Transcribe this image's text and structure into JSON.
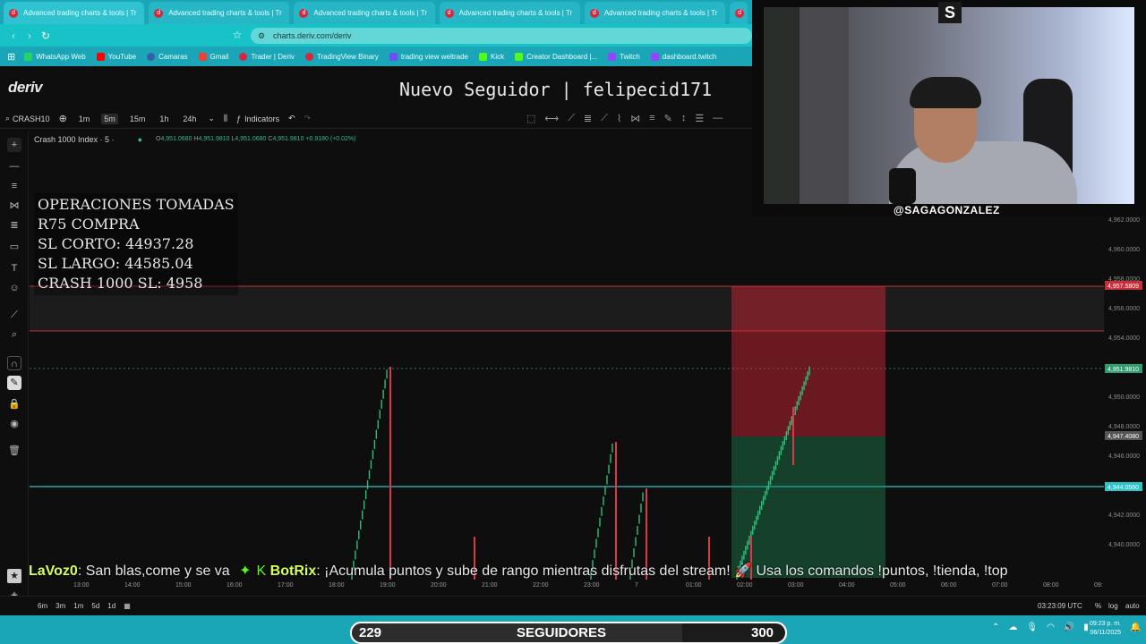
{
  "browser": {
    "tabs": [
      "Advanced trading charts & tools | Tr",
      "Advanced trading charts & tools | Tr",
      "Advanced trading charts & tools | Tr",
      "Advanced trading charts & tools | Tr",
      "Advanced trading charts & tools | Tr"
    ],
    "url": "charts.deriv.com/deriv",
    "bookmarks": [
      "WhatsApp Web",
      "YouTube",
      "Camaras",
      "Gmail",
      "Trader | Deriv",
      "TradingView Binary",
      "trading view weltrade",
      "Kick",
      "Creator Dashboard |...",
      "Twitch",
      "dashboard.twitch"
    ],
    "bookmark_colors": [
      "#25d366",
      "#ff0000",
      "#3a5da8",
      "#ea4335",
      "#d7263d",
      "#d7263d",
      "#6e4ff5",
      "#53fc18",
      "#53fc18",
      "#9146ff",
      "#9146ff"
    ]
  },
  "app": {
    "logo": "deriv",
    "alert": "Nuevo Seguidor | felipecid171"
  },
  "toolbar": {
    "symbol": "CRASH10",
    "timeframes": [
      "1m",
      "5m",
      "15m",
      "1h",
      "24h"
    ],
    "active_timeframe": "5m",
    "indicators": "Indicators"
  },
  "chart": {
    "legend": "Crash 1000 Index · 5 ·",
    "ohlc": {
      "o": "4,951.0680",
      "h": "4,951.9810",
      "l": "4,951.0680",
      "c": "4,951.9810",
      "change": "+0.9180 (+0.02%)"
    }
  },
  "overlay": {
    "title": "OPERACIONES TOMADAS",
    "lines": [
      "R75 COMPRA",
      "SL CORTO: 44937.28",
      "SL LARGO: 44585.04",
      "CRASH 1000 SL: 4958"
    ]
  },
  "webcam": {
    "handle": "@SAGAGONZALEZ"
  },
  "price_axis": {
    "labels": [
      "4,962.0000",
      "4,960.0000",
      "4,958.0000",
      "4,956.0000",
      "4,954.0000",
      "4,952.0000",
      "4,950.0000",
      "4,948.0000",
      "4,946.0000",
      "4,944.0000",
      "4,942.0000",
      "4,940.0000"
    ],
    "tags": {
      "red": "4,957.5809",
      "current": "4,951.9810",
      "mid": "4,947.4080",
      "line": "4,944.0560"
    }
  },
  "time_axis": [
    "13:00",
    "14:00",
    "15:00",
    "16:00",
    "17:00",
    "18:00",
    "19:00",
    "20:00",
    "21:00",
    "22:00",
    "23:00",
    "7",
    "01:00",
    "02:00",
    "03:00",
    "04:00",
    "05:00",
    "06:00",
    "07:00",
    "08:00",
    "09:"
  ],
  "ticker": {
    "user1": "LaVoz0",
    "msg1": ": San blas,come y se va",
    "user2": "BotRix",
    "msg2": ": ¡Acumula puntos y sube de rango mientras disfrutas del stream! 🚀 Usa los comandos !puntos, !tienda, !top"
  },
  "bottom": {
    "periods": [
      "6m",
      "3m",
      "1m",
      "5d",
      "1d"
    ],
    "clock": "03:23:09 UTC",
    "percent": "%",
    "log": "log",
    "auto": "auto"
  },
  "taskbar": {
    "time": "09:23 p. m.",
    "date": "06/11/2025"
  },
  "followers": {
    "current": "229",
    "label": "SEGUIDORES",
    "goal": "300"
  }
}
